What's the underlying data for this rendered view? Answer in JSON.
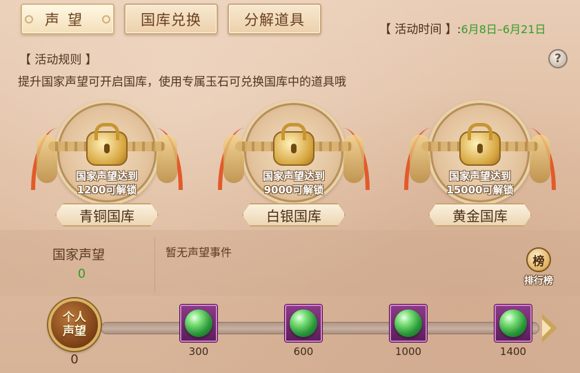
{
  "tabs": [
    {
      "label": "声望",
      "active": true
    },
    {
      "label": "国库兑换",
      "active": false
    },
    {
      "label": "分解道具",
      "active": false
    }
  ],
  "activity": {
    "label": "【 活动时间 】:",
    "dates": "6月8日–6月21日"
  },
  "rules": {
    "title": "【 活动规则 】",
    "text": "提升国家声望可开启国库，使用专属玉石可兑换国库中的道具哦",
    "help_icon": "?"
  },
  "vaults": [
    {
      "condition_line1": "国家声望达到",
      "condition_line2": "1200可解锁",
      "name": "青铜国库"
    },
    {
      "condition_line1": "国家声望达到",
      "condition_line2": "9000可解锁",
      "name": "白银国库"
    },
    {
      "condition_line1": "国家声望达到",
      "condition_line2": "15000可解锁",
      "name": "黄金国库"
    }
  ],
  "national_reputation": {
    "label": "国家声望",
    "value": "0"
  },
  "events": {
    "empty_text": "暂无声望事件"
  },
  "ranking": {
    "icon_text": "榜",
    "label": "排行榜"
  },
  "personal": {
    "badge_line1": "个人",
    "badge_line2": "声望",
    "value": "0"
  },
  "rewards": [
    {
      "threshold": "300",
      "item": "green-jade-orb"
    },
    {
      "threshold": "600",
      "item": "green-jade-orb"
    },
    {
      "threshold": "1000",
      "item": "green-jade-orb"
    },
    {
      "threshold": "1400",
      "item": "green-jade-orb"
    }
  ],
  "colors": {
    "highlight_green": "#2f9e2a",
    "reward_frame": "#8a3b86"
  }
}
